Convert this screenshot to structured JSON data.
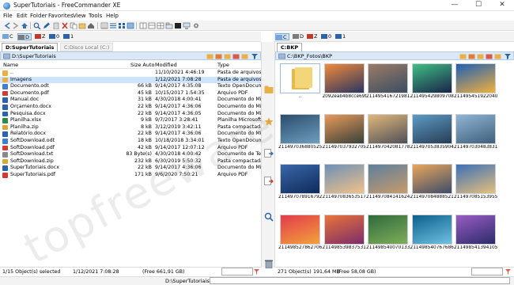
{
  "window": {
    "title": "SuperTutoriais - FreeCommander XE",
    "minimize_icon": "minimize-icon",
    "maximize_icon": "maximize-icon",
    "close_icon": "close-icon"
  },
  "menu": [
    "File",
    "Edit",
    "Folder",
    "Favorites",
    "View",
    "Tools",
    "Help"
  ],
  "left": {
    "drives": [
      {
        "label": "C",
        "active": false
      },
      {
        "label": "D",
        "active": true
      },
      {
        "label": "Z",
        "active": false
      },
      {
        "label": "0",
        "active": false
      },
      {
        "label": "1",
        "active": false
      }
    ],
    "tabs": [
      {
        "label": "D:SuperTutoriais",
        "active": true
      },
      {
        "label": "C:Disco Local (C:)",
        "active": false
      }
    ],
    "path": "D:\\SuperTutoriais",
    "columns": {
      "name": "Name",
      "size": "Size Auto",
      "modified": "Modified",
      "type": "Type"
    },
    "files": [
      {
        "name": "..",
        "size": "",
        "modified": "11/10/2021 4:46:19",
        "type": "Pasta de arquivos",
        "kind": "folder"
      },
      {
        "name": "Imagens",
        "size": "",
        "modified": "1/12/2021 7:08:28",
        "type": "Pasta de arquivos",
        "kind": "folder"
      },
      {
        "name": "Documento.odt",
        "size": "66 kB",
        "modified": "9/14/2017 4:35:08",
        "type": "Texto OpenDocume",
        "kind": "odt"
      },
      {
        "name": "Documento.pdf",
        "size": "45 kB",
        "modified": "10/15/2017 1:54:35",
        "type": "Arquivo PDF",
        "kind": "pdf"
      },
      {
        "name": "Manual.doc",
        "size": "31 kB",
        "modified": "4/30/2018 4:00:41",
        "type": "Documento do Micr",
        "kind": "doc"
      },
      {
        "name": "Orçamento.docx",
        "size": "22 kB",
        "modified": "9/14/2017 4:36:06",
        "type": "Documento do Micr",
        "kind": "doc"
      },
      {
        "name": "Pesquisa.docx",
        "size": "22 kB",
        "modified": "9/14/2017 4:36:05",
        "type": "Documento do Micr",
        "kind": "doc"
      },
      {
        "name": "Planilha.xlsx",
        "size": "9 kB",
        "modified": "9/7/2017 3:28:41",
        "type": "Planilha Microsoft E",
        "kind": "xls"
      },
      {
        "name": "Planilha.zip",
        "size": "8 kB",
        "modified": "3/12/2019 3:42:11",
        "type": "Pasta compactada",
        "kind": "zip"
      },
      {
        "name": "Relatório.docx",
        "size": "22 kB",
        "modified": "9/14/2017 4:36:06",
        "type": "Documento do Micr",
        "kind": "doc"
      },
      {
        "name": "SoftDownload.odt",
        "size": "18 kB",
        "modified": "10/18/2018 3:34:01",
        "type": "Texto OpenDocume",
        "kind": "odt"
      },
      {
        "name": "SoftDownload.pdf",
        "size": "42 kB",
        "modified": "9/14/2017 12:07:12",
        "type": "Arquivo PDF",
        "kind": "pdf"
      },
      {
        "name": "SoftDownload.txt",
        "size": "83 Byte(s)",
        "modified": "4/30/2018 4:00:42",
        "type": "Documento de Text",
        "kind": "txt"
      },
      {
        "name": "SoftDownload.zip",
        "size": "232 kB",
        "modified": "6/30/2019 5:50:32",
        "type": "Pasta compactada",
        "kind": "zip"
      },
      {
        "name": "SuperTutoriais.docx",
        "size": "22 kB",
        "modified": "9/14/2017 4:36:06",
        "type": "Documento do Micr",
        "kind": "doc"
      },
      {
        "name": "SuperTutoriais.pdf",
        "size": "171 kB",
        "modified": "9/6/2020 7:50:21",
        "type": "Arquivo PDF",
        "kind": "pdf"
      }
    ],
    "status": {
      "selected": "1/15 Object(s) selected",
      "date": "1/12/2021 7:08:28",
      "free": "(Free 661,91 GB)"
    }
  },
  "right": {
    "drives": [
      {
        "label": "C",
        "active": true
      },
      {
        "label": "D",
        "active": false
      },
      {
        "label": "Z",
        "active": false
      },
      {
        "label": "0",
        "active": false
      },
      {
        "label": "1",
        "active": false
      }
    ],
    "tabs": [
      {
        "label": "C:BKP",
        "active": true
      }
    ],
    "path": "C:\\BKP_Fotos\\BKP",
    "thumbs": [
      {
        "caption": "..",
        "kind": "folder",
        "colors": [
          "#f4d67a",
          "#e8b84a"
        ]
      },
      {
        "caption": "2092eab4b8cce69f3",
        "colors": [
          "#f08a3c",
          "#2a3560"
        ]
      },
      {
        "caption": "2114954167219815",
        "colors": [
          "#9a7c66",
          "#3b4d62"
        ]
      },
      {
        "caption": "2114954298097086",
        "colors": [
          "#3fbf85",
          "#1a2248"
        ]
      },
      {
        "caption": "2114954519220407",
        "colors": [
          "#1e5fb8",
          "#f2b13a"
        ]
      },
      {
        "caption": "2114970368805251",
        "colors": [
          "#2a4d6b",
          "#6f9ec0"
        ]
      },
      {
        "caption": "2114970379327050",
        "colors": [
          "#e89a5a",
          "#38403a"
        ]
      },
      {
        "caption": "2114970420817783",
        "colors": [
          "#e0b77a",
          "#4f4f58"
        ]
      },
      {
        "caption": "2114970538359045",
        "colors": [
          "#5d9bc4",
          "#273d55"
        ]
      },
      {
        "caption": "2114970304838314",
        "colors": [
          "#8fb6d4",
          "#3f5f7c"
        ]
      },
      {
        "caption": "2114970789167920",
        "colors": [
          "#3a66a8",
          "#0e2a5a"
        ]
      },
      {
        "caption": "2114970836535172",
        "colors": [
          "#6e8fb6",
          "#f0c28a"
        ]
      },
      {
        "caption": "2114970841416241",
        "colors": [
          "#5d7f9e",
          "#c79b6a"
        ]
      },
      {
        "caption": "2114970848885213",
        "colors": [
          "#e9a65c",
          "#3d4c6a"
        ]
      },
      {
        "caption": "2114970851539559",
        "colors": [
          "#3c6fb8",
          "#e6c07c"
        ]
      },
      {
        "caption": "2114985278627066",
        "colors": [
          "#e23b4a",
          "#f2a23c"
        ]
      },
      {
        "caption": "2114985398375313",
        "colors": [
          "#e9743a",
          "#7c2c6a"
        ]
      },
      {
        "caption": "2114985400701330",
        "colors": [
          "#2f6a3c",
          "#7fae5a"
        ]
      },
      {
        "caption": "2114985407676868",
        "colors": [
          "#0c5f8c",
          "#6fc2e0"
        ]
      },
      {
        "caption": "2114985413941055",
        "colors": [
          "#9a5cc4",
          "#2b2c6a"
        ]
      }
    ],
    "status": {
      "objects": "271 Object(s)",
      "size": "191,64 MB",
      "free": "(Free 58,08 GB)"
    }
  },
  "command_line": {
    "label": "D:\\SuperTutoriais\\>",
    "value": ""
  },
  "watermark": "topfreeware",
  "side_icons": [
    "folder-move-icon",
    "favorites-star-icon",
    "copy-to-right-icon",
    "move-to-right-icon",
    "search-icon",
    "recycle-bin-icon"
  ]
}
